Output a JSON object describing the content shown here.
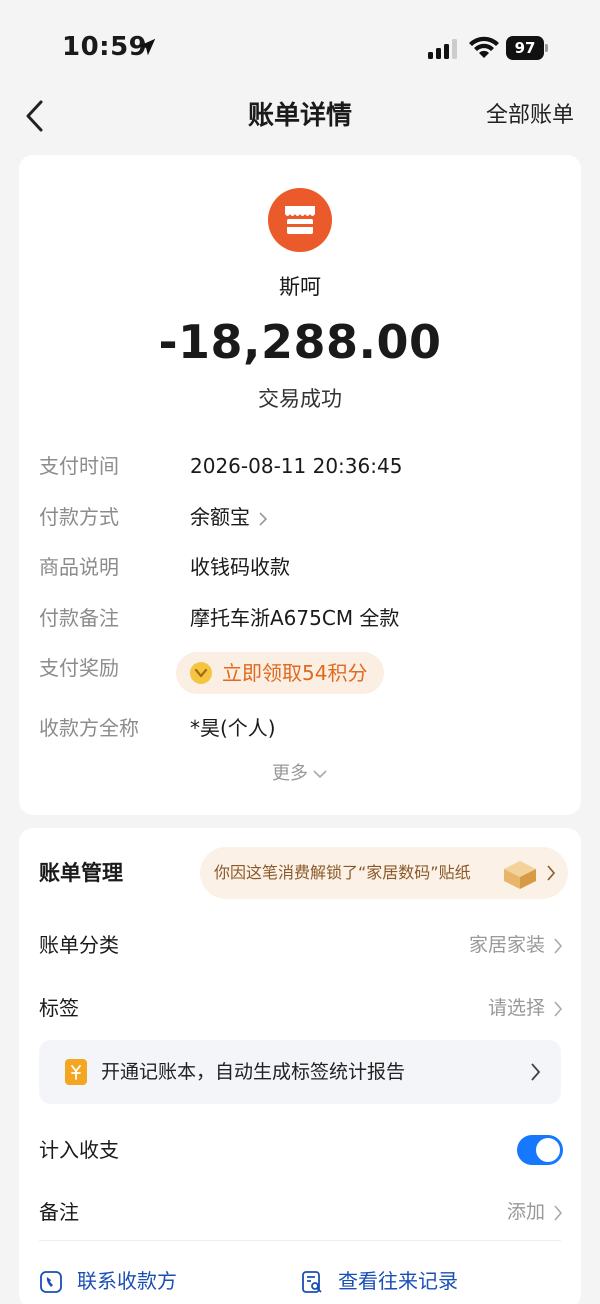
{
  "status_bar": {
    "time": "10:59",
    "battery": "97"
  },
  "nav": {
    "title": "账单详情",
    "right_link": "全部账单"
  },
  "merchant": {
    "name": "斯呵",
    "amount": "-18,288.00",
    "status": "交易成功"
  },
  "details": [
    {
      "label": "支付时间",
      "value": "2026-08-11 20:36:45"
    },
    {
      "label": "付款方式",
      "value": "余额宝"
    },
    {
      "label": "商品说明",
      "value": "收钱码收款"
    },
    {
      "label": "付款备注",
      "value": "摩托车浙A675CM 全款"
    },
    {
      "label": "支付奖励",
      "value": "立即领取54积分"
    },
    {
      "label": "收款方全称",
      "value": "*昊(个人)"
    }
  ],
  "more_label": "更多",
  "management": {
    "title": "账单管理",
    "sticker_text": "你因这笔消费解锁了“家居数码”贴纸",
    "category_label": "账单分类",
    "category_value": "家居家装",
    "tag_label": "标签",
    "tag_value": "请选择",
    "promo_text": "开通记账本，自动生成标签统计报告",
    "include_label": "计入收支",
    "include_enabled": true,
    "remark_label": "备注",
    "remark_value": "添加"
  },
  "actions": {
    "contact": "联系收款方",
    "history": "查看往来记录"
  },
  "colors": {
    "accent": "#1677ff",
    "merchant": "#ea5a2a",
    "reward": "#e06a1f"
  }
}
